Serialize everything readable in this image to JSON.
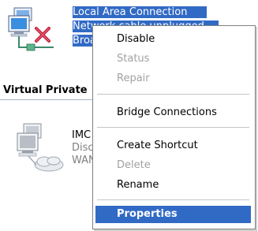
{
  "connections": {
    "lan": {
      "icon": "network-connection-unplugged-icon",
      "name": "Local Area Connection",
      "status": "Network cable unplugged",
      "device": "Broadcom NetXtreme Gigabit Ethernet"
    },
    "vpn_section": {
      "header": "Virtual Private Network"
    },
    "vpn": {
      "icon": "vpn-connection-icon",
      "name": "IMC",
      "status": "Disconnected",
      "device": "WAN Miniport (PPTP)"
    }
  },
  "context_menu": {
    "items": [
      {
        "label": "Disable",
        "state": "enabled"
      },
      {
        "label": "Status",
        "state": "disabled"
      },
      {
        "label": "Repair",
        "state": "disabled"
      },
      {
        "label": "Bridge Connections",
        "state": "enabled"
      },
      {
        "label": "Create Shortcut",
        "state": "enabled"
      },
      {
        "label": "Delete",
        "state": "disabled"
      },
      {
        "label": "Rename",
        "state": "enabled"
      },
      {
        "label": "Properties",
        "state": "default-highlighted"
      }
    ]
  },
  "colors": {
    "selection": "#316ac5",
    "disabled_text": "#a1a1a1",
    "menu_border": "#808080"
  }
}
